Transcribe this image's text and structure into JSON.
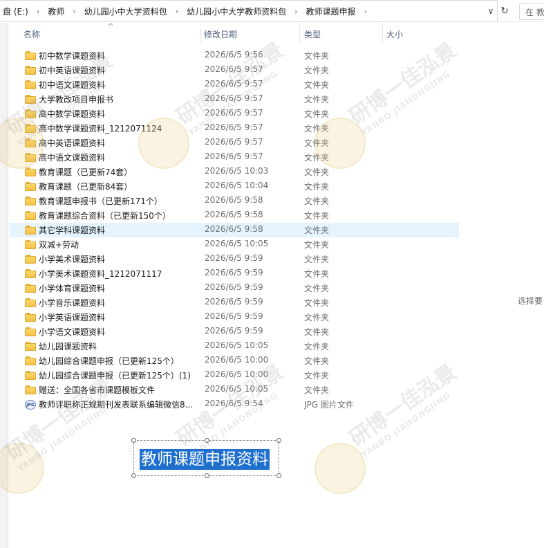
{
  "address_bar": {
    "crumbs": [
      "盘 (E:)",
      "教师",
      "幼儿园小中大学资料包",
      "幼儿园小中大学教师资料包",
      "教师课题申报"
    ],
    "search_placeholder": "在 教"
  },
  "columns": {
    "name": "名称",
    "date": "修改日期",
    "type": "类型",
    "size": "大小"
  },
  "files": [
    {
      "name": "初中数学课题资料",
      "date": "2026/6/5 9:56",
      "type": "文件夹",
      "icon": "folder-icon"
    },
    {
      "name": "初中英语课题资料",
      "date": "2026/6/5 9:57",
      "type": "文件夹",
      "icon": "folder-icon"
    },
    {
      "name": "初中语文课题资料",
      "date": "2026/6/5 9:57",
      "type": "文件夹",
      "icon": "folder-icon"
    },
    {
      "name": "大学教改项目申报书",
      "date": "2026/6/5 9:57",
      "type": "文件夹",
      "icon": "folder-icon"
    },
    {
      "name": "高中数学课题资料",
      "date": "2026/6/5 9:57",
      "type": "文件夹",
      "icon": "folder-icon"
    },
    {
      "name": "高中数学课题资料_1212071124",
      "date": "2026/6/5 9:57",
      "type": "文件夹",
      "icon": "folder-icon"
    },
    {
      "name": "高中英语课题资料",
      "date": "2026/6/5 9:57",
      "type": "文件夹",
      "icon": "folder-icon"
    },
    {
      "name": "高中语文课题资料",
      "date": "2026/6/5 9:57",
      "type": "文件夹",
      "icon": "folder-icon"
    },
    {
      "name": "教育课题（已更新74套）",
      "date": "2026/6/5 10:03",
      "type": "文件夹",
      "icon": "folder-icon"
    },
    {
      "name": "教育课题（已更新84套）",
      "date": "2026/6/5 10:04",
      "type": "文件夹",
      "icon": "folder-icon"
    },
    {
      "name": "教育课题申报书（已更新171个）",
      "date": "2026/6/5 9:58",
      "type": "文件夹",
      "icon": "folder-icon"
    },
    {
      "name": "教育课题综合资料（已更新150个）",
      "date": "2026/6/5 9:58",
      "type": "文件夹",
      "icon": "folder-icon"
    },
    {
      "name": "其它学科课题资料",
      "date": "2026/6/5 9:58",
      "type": "文件夹",
      "icon": "folder-icon",
      "selected": true
    },
    {
      "name": "双减+劳动",
      "date": "2026/6/5 10:05",
      "type": "文件夹",
      "icon": "folder-icon"
    },
    {
      "name": "小学美术课题资料",
      "date": "2026/6/5 9:59",
      "type": "文件夹",
      "icon": "folder-icon"
    },
    {
      "name": "小学美术课题资料_1212071117",
      "date": "2026/6/5 9:59",
      "type": "文件夹",
      "icon": "folder-icon"
    },
    {
      "name": "小学体育课题资料",
      "date": "2026/6/5 9:59",
      "type": "文件夹",
      "icon": "folder-icon"
    },
    {
      "name": "小学音乐课题资料",
      "date": "2026/6/5 9:59",
      "type": "文件夹",
      "icon": "folder-icon"
    },
    {
      "name": "小学英语课题资料",
      "date": "2026/6/5 9:59",
      "type": "文件夹",
      "icon": "folder-icon"
    },
    {
      "name": "小学语文课题资料",
      "date": "2026/6/5 9:59",
      "type": "文件夹",
      "icon": "folder-icon"
    },
    {
      "name": "幼儿园课题资料",
      "date": "2026/6/5 10:05",
      "type": "文件夹",
      "icon": "folder-icon"
    },
    {
      "name": "幼儿园综合课题申报（已更新125个）",
      "date": "2026/6/5 10:00",
      "type": "文件夹",
      "icon": "folder-icon"
    },
    {
      "name": "幼儿园综合课题申报（已更新125个）(1)",
      "date": "2026/6/5 10:00",
      "type": "文件夹",
      "icon": "folder-icon"
    },
    {
      "name": "赠送：全国各省市课题模板文件",
      "date": "2026/6/5 10:05",
      "type": "文件夹",
      "icon": "folder-icon"
    },
    {
      "name": "教师评职称正规期刊发表联系编辑微信8...",
      "date": "2026/6/5 9:54",
      "type": "JPG 图片文件",
      "icon": "jpg-file-icon"
    }
  ],
  "preview_pane": {
    "note": "选择要"
  },
  "overlay": {
    "title": "教师课题申报资料"
  },
  "watermark": {
    "main": "研博一佳泓景",
    "sub": "YANBO JIAHONGJING"
  },
  "colors": {
    "selected_row": "#e5f3ff",
    "folder": "#f2c14a",
    "overlay_bg": "#1f6fcf",
    "header_text": "#4c607a"
  }
}
